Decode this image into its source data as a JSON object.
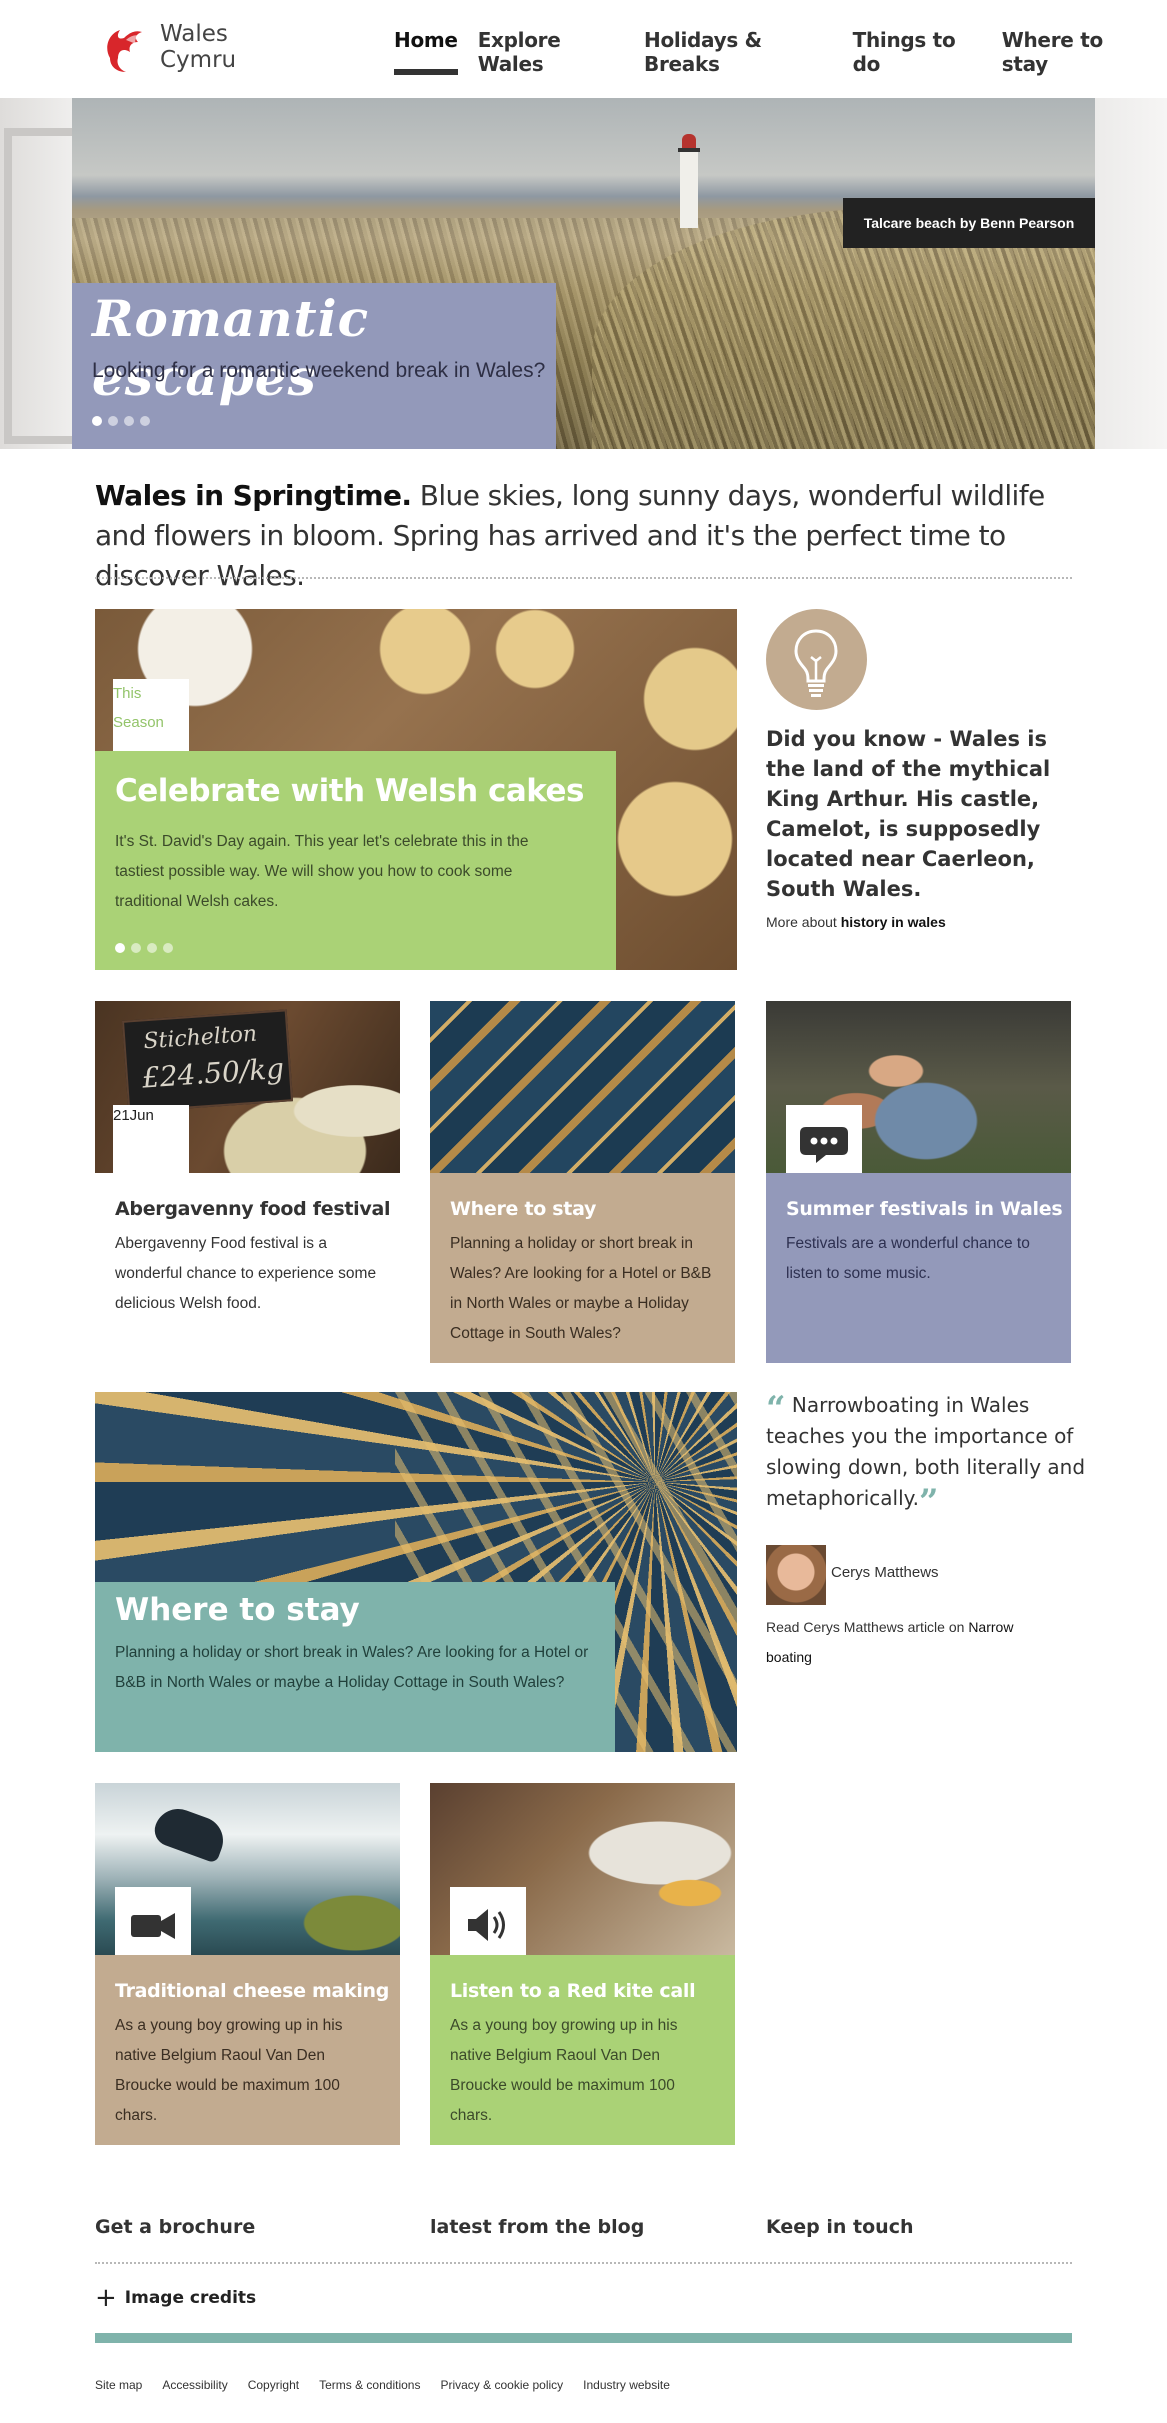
{
  "header": {
    "logo_line1": "Wales",
    "logo_line2": "Cymru",
    "nav": [
      "Home",
      "Explore Wales",
      "Holidays & Breaks",
      "Things to do",
      "Where to stay"
    ],
    "active_nav": "Home"
  },
  "hero": {
    "credit": "Talcare beach by Benn Pearson",
    "title": "Romantic escapes",
    "subtitle": "Looking for a romantic weekend break in Wales?",
    "slides": 4,
    "active_slide": 1
  },
  "intro": {
    "lead": "Wales in Springtime.",
    "text": " Blue skies, long sunny days, wonderful wildlife and flowers in bloom. Spring has arrived and it's the perfect time to discover Wales."
  },
  "feature": {
    "tag_line1": "This",
    "tag_line2": "Season",
    "title": "Celebrate with Welsh cakes",
    "description": "It's St. David's Day again. This year let's celebrate this in the tastiest possible way. We will show you how to cook some traditional Welsh cakes.",
    "slides": 4,
    "active_slide": 1
  },
  "did_you_know": {
    "icon": "lightbulb-icon",
    "text": "Did you know - Wales is the land of the mythical King Arthur. His castle, Camelot, is supposedly located near Caerleon, South Wales.",
    "more_prefix": "More about ",
    "more_link": "history in wales"
  },
  "cards": [
    {
      "date": "21Jun",
      "title": "Abergavenny food festival",
      "text": "Abergavenny Food festival is a wonderful chance to experience some delicious Welsh food.",
      "sign": [
        "Stichelton",
        "£24.50/kg"
      ],
      "color": "#ffffff"
    },
    {
      "title": "Where to stay",
      "text": "Planning a holiday or short break in Wales? Are looking for a Hotel or B&B in North Wales or maybe a Holiday Cottage in South Wales?",
      "color": "#c2ab90"
    },
    {
      "icon": "speech-bubble-icon",
      "title": "Summer festivals in Wales",
      "text": "Festivals are a wonderful chance to listen to some music.",
      "color": "#9399ba"
    }
  ],
  "feature2": {
    "title": "Where to stay",
    "description": "Planning a holiday or short break in Wales? Are looking for a Hotel or B&B in North Wales or maybe a Holiday Cottage in South Wales?",
    "color": "#7fb3ab"
  },
  "quote": {
    "text": "Narrowboating in Wales teaches you the importance of slowing down, both literally and metaphorically.",
    "author": "Cerys Matthews",
    "read_prefix": "Read Cerys Matthews article on ",
    "read_link": "Narrow boating"
  },
  "media_cards": [
    {
      "icon": "video-camera-icon",
      "title": "Traditional cheese making",
      "text": "As a young boy growing up in his native Belgium Raoul Van Den Broucke would be maximum 100 chars.",
      "color": "#c2ab90"
    },
    {
      "icon": "speaker-icon",
      "title": "Listen to a Red kite call",
      "text": "As a young boy growing up in his native Belgium Raoul Van Den Broucke would be maximum 100 chars.",
      "color": "#aad276"
    }
  ],
  "footer": {
    "headings": [
      "Get a brochure",
      "latest from the blog",
      "Keep in touch"
    ],
    "credits": "Image credits",
    "links": [
      "Site map",
      "Accessibility",
      "Copyright",
      "Terms & conditions",
      "Privacy & cookie policy",
      "Industry website"
    ],
    "bar_color": "#7fb3ab"
  }
}
